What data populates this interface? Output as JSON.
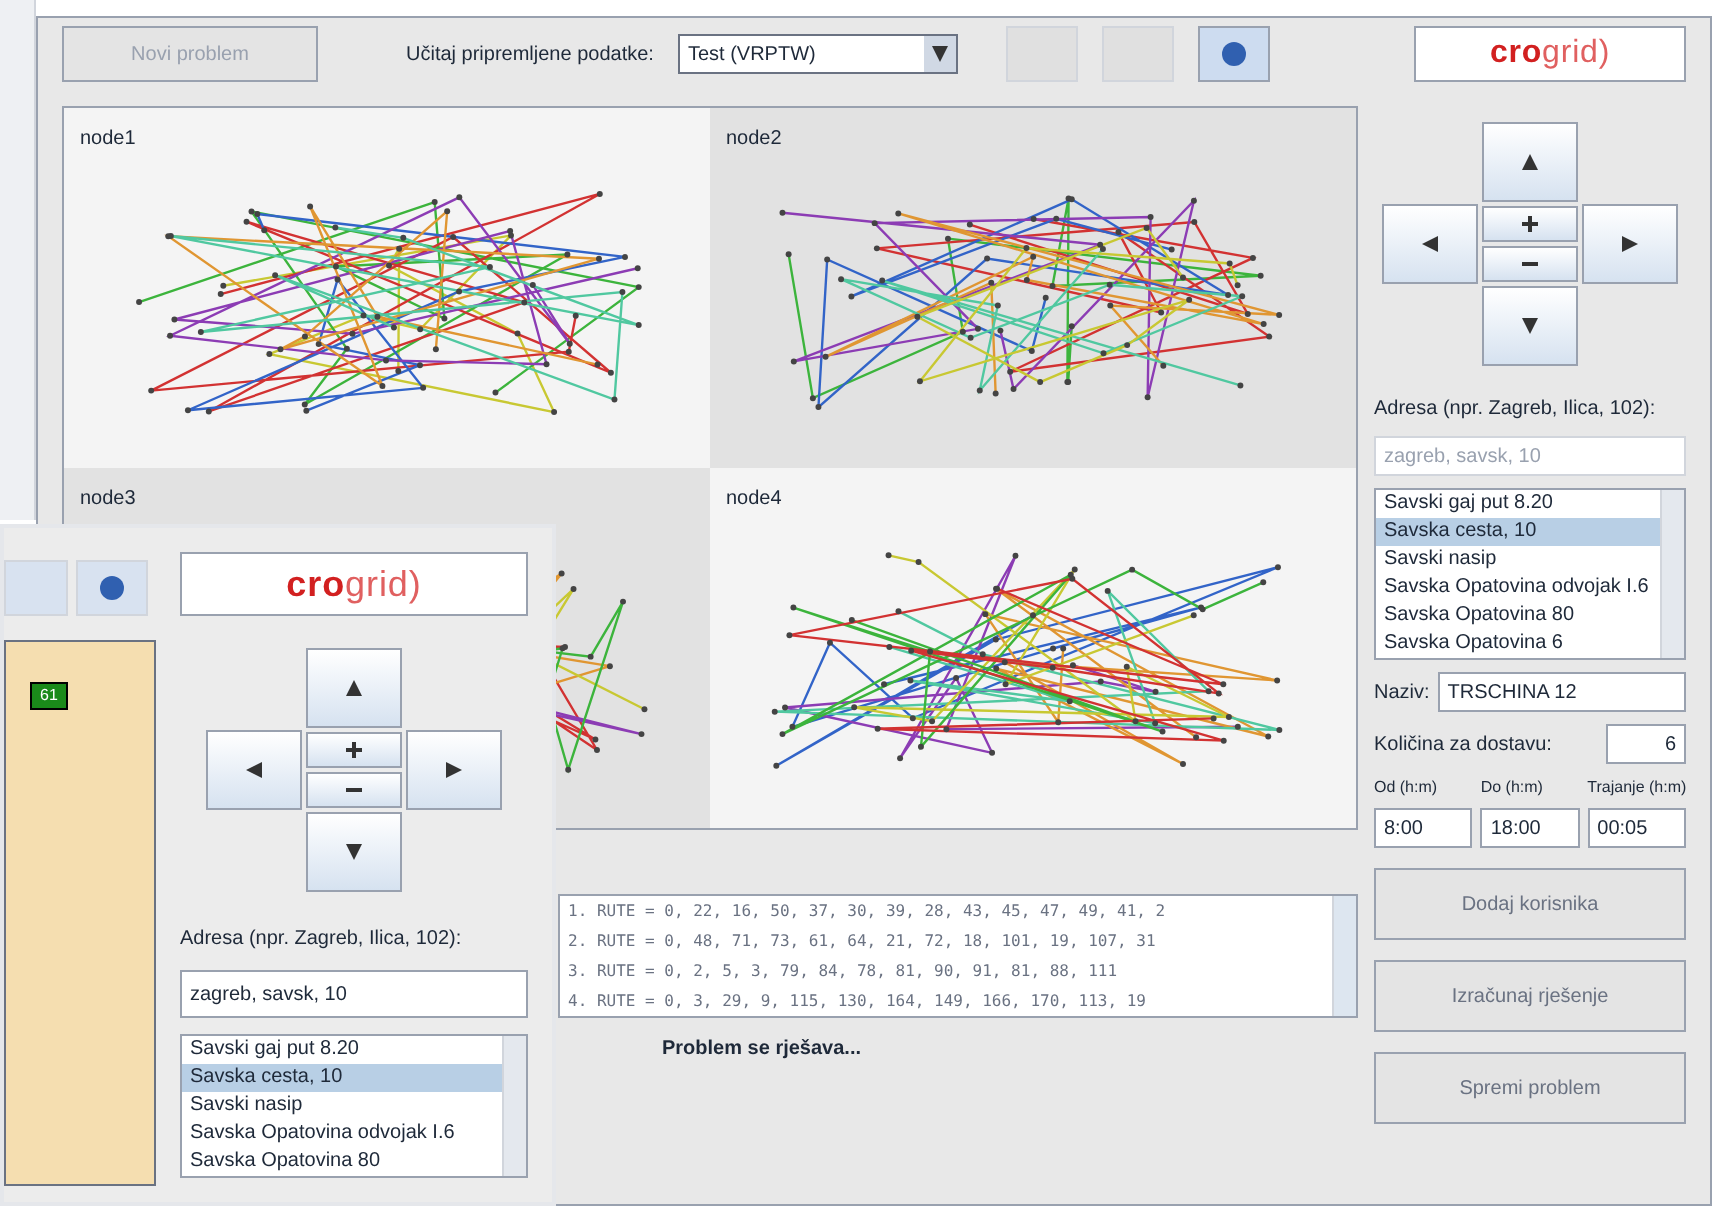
{
  "toolbar": {
    "new_button": {
      "label": "Novi problem",
      "disabled": true
    },
    "load_label": "Učitaj pripremljene podatke:",
    "dataset": "Test (VRPTW)",
    "logo": {
      "prefix": "cro",
      "suffix": "grid)"
    }
  },
  "nodes": [
    {
      "label": "node1"
    },
    {
      "label": "node2"
    },
    {
      "label": "node3"
    },
    {
      "label": "node4"
    }
  ],
  "side": {
    "address_label": "Adresa (npr. Zagreb, Ilica, 102):",
    "address_value": "zagreb, savsk, 10",
    "results": [
      {
        "text": "Savski gaj put 8.20",
        "selected": false
      },
      {
        "text": "Savska cesta, 10",
        "selected": true
      },
      {
        "text": "Savski nasip",
        "selected": false
      },
      {
        "text": "Savska Opatovina odvojak I.6",
        "selected": false
      },
      {
        "text": "Savska Opatovina 80",
        "selected": false
      },
      {
        "text": "Savska Opatovina 6",
        "selected": false
      }
    ],
    "name_label": "Naziv:",
    "name_value": "TRSCHINA 12",
    "qty_label": "Količina za dostavu:",
    "qty_value": "6",
    "times": [
      {
        "label": "Od (h:m)",
        "value": "8:00"
      },
      {
        "label": "Do (h:m)",
        "value": "18:00"
      },
      {
        "label": "Trajanje (h:m)",
        "value": "00:05"
      }
    ],
    "buttons": [
      "Dodaj korisnika",
      "Izračunaj rješenje",
      "Spremi problem"
    ]
  },
  "log": [
    "1. RUTE = 0, 22, 16, 50, 37, 30, 39, 28, 43, 45, 47, 49, 41, 2",
    "2. RUTE = 0, 48, 71, 73, 61, 64, 21, 72, 18, 101, 19, 107, 31",
    "3. RUTE = 0, 2, 5, 3, 79, 84, 78, 81, 90, 91, 81, 88, 111",
    "4. RUTE = 0, 3, 29, 9, 115, 130, 164, 149, 166, 170, 113, 19"
  ],
  "status": "Problem se rješava...",
  "overlay": {
    "logo": {
      "prefix": "cro",
      "suffix": "grid)"
    },
    "address_label": "Adresa (npr. Zagreb, Ilica, 102):",
    "address_value": "zagreb, savsk, 10",
    "results": [
      {
        "text": "Savski gaj put 8.20",
        "selected": false
      },
      {
        "text": "Savska cesta, 10",
        "selected": true
      },
      {
        "text": "Savski nasip",
        "selected": false
      },
      {
        "text": "Savska Opatovina odvojak I.6",
        "selected": false
      },
      {
        "text": "Savska Opatovina 80",
        "selected": false
      }
    ],
    "map_marker": "61"
  }
}
